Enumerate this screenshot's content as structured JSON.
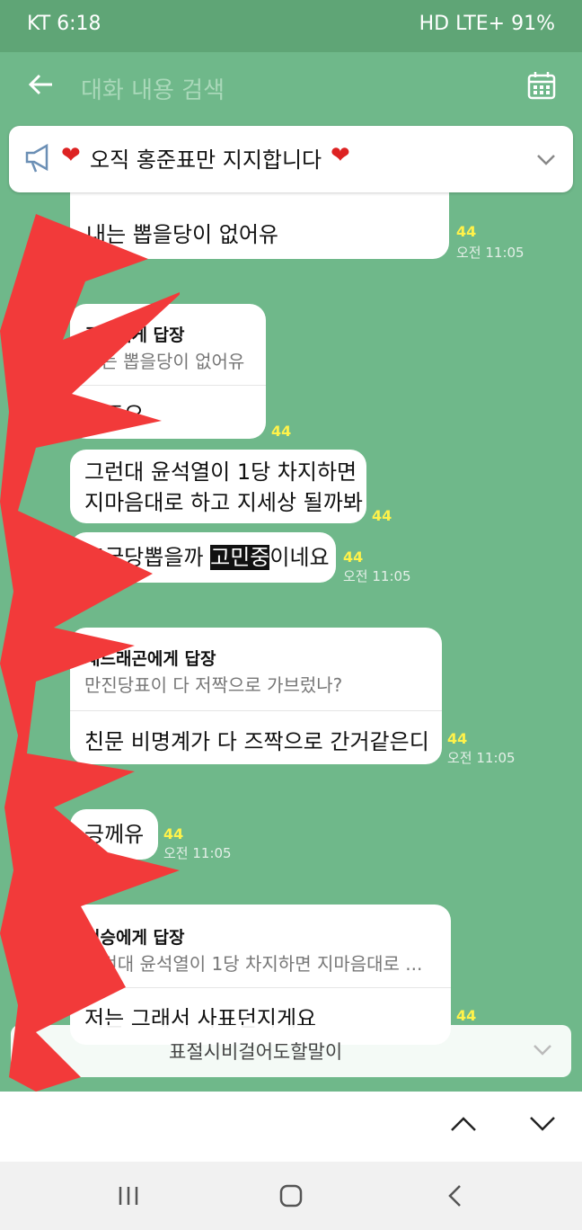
{
  "status": {
    "carrier_time": "KT 6:18",
    "right": "HD LTE+ 91%"
  },
  "topbar": {
    "search_placeholder": "대화 내용 검색"
  },
  "notice": {
    "text": "오직 홍준표만 지지합니다"
  },
  "messages": [
    {
      "text": "내는 뽑을당이 없어유",
      "count": "44",
      "time": "오전 11:05"
    },
    {
      "reply_to": "공직에게 답장",
      "quote": "내는 뽑을당이 없어유",
      "text": "저도요",
      "count": "44"
    },
    {
      "line1": "그런대 윤석열이 1당 차지하면",
      "line2": "지마음대로 하고 지세상 될까봐",
      "count": "44"
    },
    {
      "pre": "조국당뽑을까 ",
      "highlight": "고민중",
      "post": "이네요",
      "count": "44",
      "time": "오전 11:05"
    },
    {
      "reply_to": "재드래곤에게 답장",
      "quote": "만진당표이 다 저짝으로 가브렀나?",
      "text": "친문 비명계가 다 즈짝으로 간거같은디",
      "count": "44",
      "time": "오전 11:05"
    },
    {
      "text": "긍께유",
      "count": "44",
      "time": "오전 11:05"
    },
    {
      "reply_to": "현승에게 답장",
      "quote": "그런대 윤석열이 1당 차지하면 지마음대로 ...",
      "text": "저는 그래서 사표던지게요",
      "count": "44"
    }
  ],
  "pinned_notice": {
    "text": "표절시비걸어도할말이"
  }
}
